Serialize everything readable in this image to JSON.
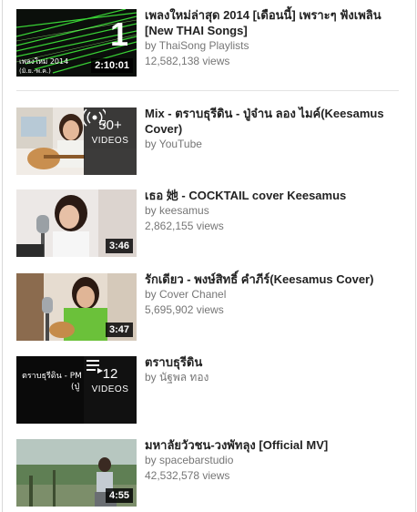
{
  "videos": [
    {
      "title": "เพลงใหม่ล่าสุด 2014 [เดือนนี้] เพราะๆ ฟังเพลิน [New THAI Songs]",
      "channel": "by ThaiSong Playlists",
      "views": "12,582,138 views",
      "duration": "2:10:01",
      "thumb_text": "เพลงใหม่ 2014",
      "thumb_text2": "(มิ.ย.-พ.ค.)",
      "thumb_number": "1"
    },
    {
      "title": "Mix - ตราบธุรีดิน - ปู่จ๋าน ลอง ไมค์(Keesamus Cover)",
      "channel": "by YouTube",
      "playlist_count": "50+",
      "playlist_label": "VIDEOS"
    },
    {
      "title": "เธอ 她 - COCKTAIL cover Keesamus",
      "channel": "by keesamus",
      "views": "2,862,155 views",
      "duration": "3:46"
    },
    {
      "title": "รักเดียว - พงษ์สิทธิ์ คำภีร์(Keesamus Cover)",
      "channel": "by Cover Chanel",
      "views": "5,695,902 views",
      "duration": "3:47"
    },
    {
      "title": "ตราบธุรีดิน",
      "channel": "by นัฐพล ทอง",
      "playlist_count": "12",
      "playlist_label": "VIDEOS",
      "thumb_text": "ตราบธุรีดิน - PM",
      "thumb_text2": "(ปู่"
    },
    {
      "title": "มหาลัยวัวชน-วงพัทลุง [Official MV]",
      "channel": "by spacebarstudio",
      "views": "42,532,578 views",
      "duration": "4:55"
    }
  ],
  "colors": {
    "title": "#222222",
    "meta": "#767676",
    "divider": "#e3e3e3"
  }
}
